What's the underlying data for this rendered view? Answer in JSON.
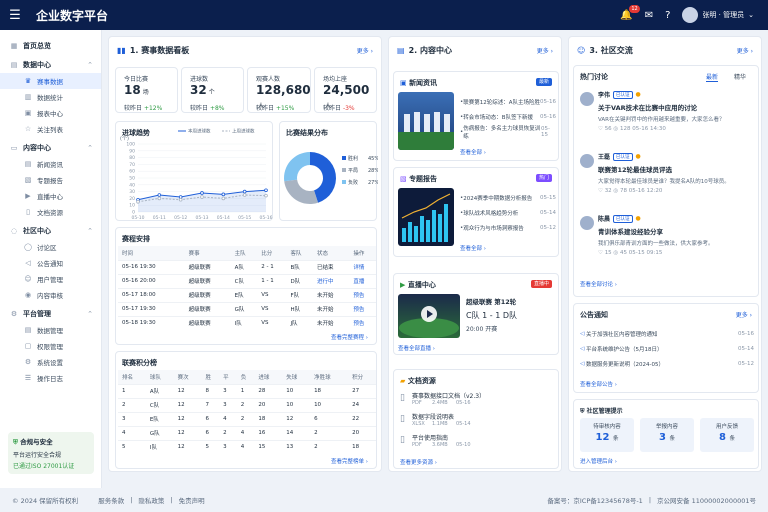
{
  "header": {
    "title": "企业数字平台",
    "bell_count": "12",
    "user_name": "张明 · 管理员"
  },
  "sidebar": {
    "home": "首页总览",
    "groups": [
      {
        "label": "数据中心",
        "items": [
          "赛事数据",
          "数据统计",
          "报表中心",
          "关注列表"
        ]
      },
      {
        "label": "内容中心",
        "items": [
          "新闻资讯",
          "专题报告",
          "直播中心",
          "文档资源"
        ]
      },
      {
        "label": "社区中心",
        "items": [
          "讨论区",
          "公告通知",
          "用户管理",
          "内容审核"
        ]
      },
      {
        "label": "平台管理",
        "items": [
          "数据管理",
          "权限管理",
          "系统设置",
          "操作日志"
        ]
      }
    ],
    "security": {
      "title": "合规与安全",
      "line1": "平台运行安全合规",
      "line2": "已通过ISO 27001认证"
    }
  },
  "match_panel": {
    "title": "1. 赛事数据看板",
    "more": "更多 ›",
    "stats": [
      {
        "label": "今日比赛",
        "value": "18",
        "unit": "场",
        "compare_label": "较昨日",
        "change": "+12%"
      },
      {
        "label": "进球数",
        "value": "32",
        "unit": "个",
        "compare_label": "较昨日",
        "change": "+8%"
      },
      {
        "label": "观赛人数",
        "value": "128,680",
        "unit": "人",
        "compare_label": "较昨日",
        "change": "+15%"
      },
      {
        "label": "场均上座",
        "value": "24,500",
        "unit": "人",
        "compare_label": "较昨日",
        "change": "-3%"
      }
    ],
    "schedule": {
      "title": "赛程安排",
      "columns": [
        "时间",
        "赛事",
        "主队",
        "比分",
        "客队",
        "状态",
        "操作"
      ],
      "rows": [
        [
          "05-16 19:30",
          "超级联赛",
          "A队",
          "2 - 1",
          "B队",
          "已结束",
          "详情"
        ],
        [
          "05-16 20:00",
          "超级联赛",
          "C队",
          "1 - 1",
          "D队",
          "进行中",
          "直播"
        ],
        [
          "05-17 18:00",
          "超级联赛",
          "E队",
          "VS",
          "F队",
          "未开始",
          "预告"
        ],
        [
          "05-17 19:30",
          "超级联赛",
          "G队",
          "VS",
          "H队",
          "未开始",
          "预告"
        ],
        [
          "05-18 19:30",
          "超级联赛",
          "I队",
          "VS",
          "J队",
          "未开始",
          "预告"
        ]
      ],
      "more": "查看完整赛程 ›"
    },
    "standings": {
      "title": "联赛积分榜",
      "columns": [
        "排名",
        "球队",
        "赛次",
        "胜",
        "平",
        "负",
        "进球",
        "失球",
        "净胜球",
        "积分"
      ],
      "rows": [
        [
          "1",
          "A队",
          "12",
          "8",
          "3",
          "1",
          "28",
          "10",
          "18",
          "27"
        ],
        [
          "2",
          "C队",
          "12",
          "7",
          "3",
          "2",
          "20",
          "10",
          "10",
          "24"
        ],
        [
          "3",
          "E队",
          "12",
          "6",
          "4",
          "2",
          "18",
          "12",
          "6",
          "22"
        ],
        [
          "4",
          "G队",
          "12",
          "6",
          "2",
          "4",
          "16",
          "14",
          "2",
          "20"
        ],
        [
          "5",
          "I队",
          "12",
          "5",
          "3",
          "4",
          "15",
          "13",
          "2",
          "18"
        ]
      ],
      "more": "查看完整榜单 ›"
    }
  },
  "chart_data": [
    {
      "type": "line",
      "title": "进球趋势",
      "ylabel": "(个)",
      "categories": [
        "05-10",
        "05-11",
        "05-12",
        "05-13",
        "05-14",
        "05-15",
        "05-16"
      ],
      "series": [
        {
          "name": "本周进球数",
          "values": [
            18,
            25,
            22,
            28,
            26,
            30,
            32
          ]
        },
        {
          "name": "上周进球数",
          "values": [
            15,
            20,
            18,
            22,
            20,
            25,
            24
          ]
        }
      ],
      "ylim": [
        0,
        100
      ],
      "yticks": [
        0,
        10,
        20,
        30,
        40,
        50,
        60,
        70,
        80,
        90,
        100
      ]
    },
    {
      "type": "pie",
      "title": "比赛结果分布",
      "labels": [
        "胜利",
        "平局",
        "负败"
      ],
      "values": [
        45,
        28,
        27
      ],
      "display": [
        "45%",
        "28%",
        "27%"
      ]
    }
  ],
  "content_panel": {
    "title": "2. 内容中心",
    "more": "更多 ›",
    "news": {
      "title": "新闻资讯",
      "tag": "最新",
      "items": [
        {
          "t": "联赛第12轮综述：A队主场险胜",
          "d": "05-16"
        },
        {
          "t": "转会市场动态：B队签下新援",
          "d": "05-16"
        },
        {
          "t": "伤病报告：多名主力球员恢复训练",
          "d": "05-15"
        }
      ],
      "more": "查看全部 ›"
    },
    "reports": {
      "title": "专题报告",
      "tag": "热门",
      "items": [
        {
          "t": "2024赛季中期数据分析报告",
          "d": "05-15"
        },
        {
          "t": "球队战术风格趋势分析",
          "d": "05-14"
        },
        {
          "t": "观众行为与市场洞察报告",
          "d": "05-12"
        }
      ],
      "more": "查看全部 ›"
    },
    "live": {
      "title": "直播中心",
      "tag": "直播中",
      "match": "超级联赛 第12轮",
      "score": "C队 1 - 1 D队",
      "time": "20:00 开赛",
      "more": "查看全部直播 ›"
    },
    "docs": {
      "title": "文档资源",
      "items": [
        {
          "t": "赛事数据接口文档（v2.3）",
          "m": "PDF",
          "s": "2.4MB",
          "d": "05-16"
        },
        {
          "t": "数据字段说明表",
          "m": "XLSX",
          "s": "1.1MB",
          "d": "05-14"
        },
        {
          "t": "平台使用指南",
          "m": "PDF",
          "s": "3.6MB",
          "d": "05-10"
        }
      ],
      "more": "查看更多资源 ›"
    }
  },
  "community_panel": {
    "title": "3. 社区交流",
    "more": "更多 ›",
    "hot": {
      "title": "热门讨论",
      "tab_latest": "最新",
      "tab_featured": "精华",
      "posts": [
        {
          "name": "李伟",
          "verified": "已认证",
          "title": "关于VAR技术在比赛中应用的讨论",
          "excerpt": "VAR在关键判罚中的作用越来越重要，大家怎么看？",
          "likes": "56",
          "views": "128",
          "time": "05-16 14:30"
        },
        {
          "name": "王磊",
          "verified": "已认证",
          "title": "联赛第12轮最佳球员评选",
          "excerpt": "大家觉得本轮最佳球员是谁？我提名A队的10号球员。",
          "likes": "32",
          "views": "78",
          "time": "05-16 12:20"
        },
        {
          "name": "陈晨",
          "verified": "已认证",
          "title": "青训体系建设经验分享",
          "excerpt": "我们俱乐部青训方面的一些做法，供大家参考。",
          "likes": "15",
          "views": "45",
          "time": "05-15 09:15"
        }
      ],
      "more": "查看全部讨论 ›"
    },
    "notices": {
      "title": "公告通知",
      "more": "更多 ›",
      "items": [
        {
          "t": "关于加强社区内容管理的通知",
          "d": "05-16"
        },
        {
          "t": "平台系统维护公告（5月18日）",
          "d": "05-14"
        },
        {
          "t": "数据服务更新说明（2024-05）",
          "d": "05-12"
        }
      ],
      "all": "查看全部公告 ›"
    },
    "mgmt": {
      "title": "社区管理提示",
      "items": [
        {
          "l": "待审核内容",
          "v": "12",
          "u": "条"
        },
        {
          "l": "举报内容",
          "v": "3",
          "u": "条"
        },
        {
          "l": "用户反馈",
          "v": "8",
          "u": "条"
        }
      ],
      "more": "进入管理后台 ›"
    }
  },
  "footer": {
    "copyright": "© 2024 保留所有权利",
    "terms": "服务条款",
    "privacy": "隐私政策",
    "disclaimer": "免责声明",
    "icp": "备案号：京ICP备12345678号-1",
    "police": "京公网安备 11000002000001号"
  }
}
